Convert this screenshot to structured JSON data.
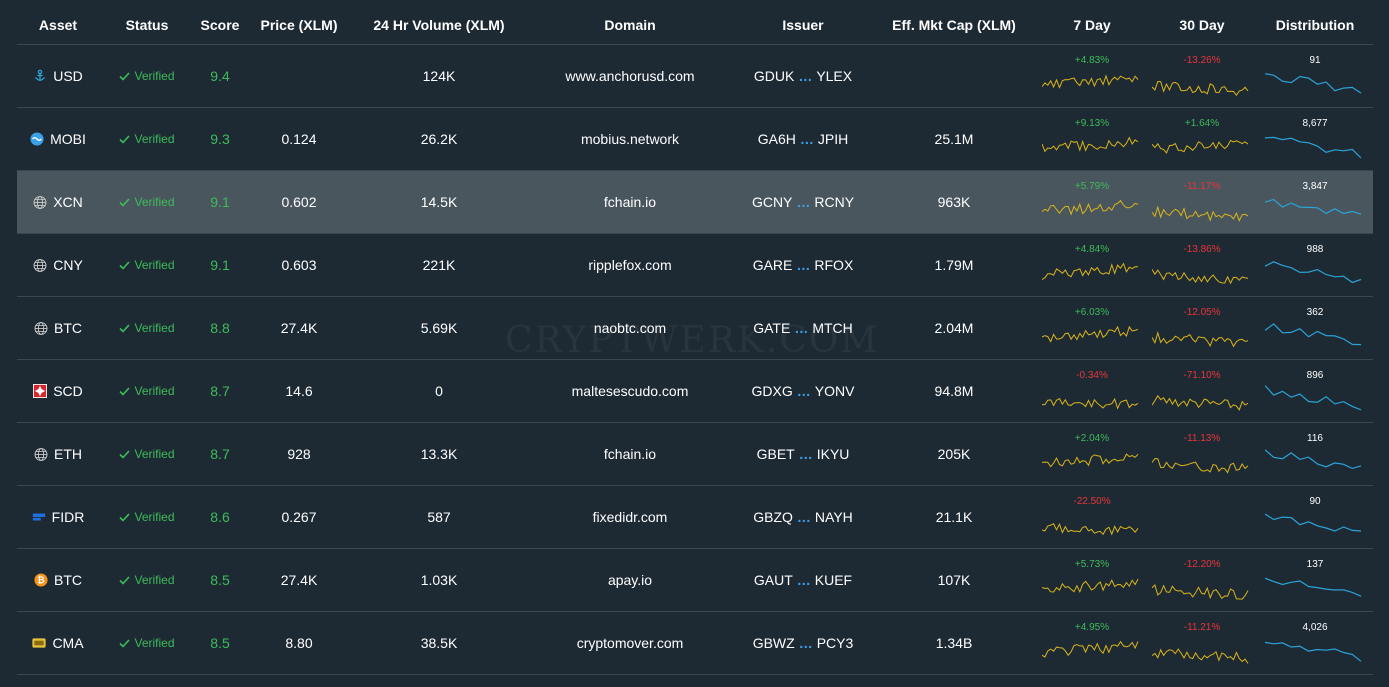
{
  "columns": [
    "Asset",
    "Status",
    "Score",
    "Price (XLM)",
    "24 Hr Volume (XLM)",
    "Domain",
    "Issuer",
    "Eff. Mkt Cap (XLM)",
    "7 Day",
    "30 Day",
    "Distribution"
  ],
  "watermark": "CRYPTWERK.COM",
  "rows": [
    {
      "asset": "USD",
      "icon": "anchor-icon",
      "status": "Verified",
      "score": "9.4",
      "price": "",
      "volume": "124K",
      "domain": "www.anchorusd.com",
      "issuer_start": "GDUK",
      "issuer_end": "YLEX",
      "mcap": "",
      "d7": "+4.83%",
      "d30": "-13.26%",
      "dist": "91"
    },
    {
      "asset": "MOBI",
      "icon": "mobius-icon",
      "status": "Verified",
      "score": "9.3",
      "price": "0.124",
      "volume": "26.2K",
      "domain": "mobius.network",
      "issuer_start": "GA6H",
      "issuer_end": "JPIH",
      "mcap": "25.1M",
      "d7": "+9.13%",
      "d30": "+1.64%",
      "dist": "8,677"
    },
    {
      "asset": "XCN",
      "icon": "globe-icon",
      "status": "Verified",
      "score": "9.1",
      "price": "0.602",
      "volume": "14.5K",
      "domain": "fchain.io",
      "issuer_start": "GCNY",
      "issuer_end": "RCNY",
      "mcap": "963K",
      "d7": "+5.79%",
      "d30": "-11.17%",
      "dist": "3,847"
    },
    {
      "asset": "CNY",
      "icon": "globe-icon",
      "status": "Verified",
      "score": "9.1",
      "price": "0.603",
      "volume": "221K",
      "domain": "ripplefox.com",
      "issuer_start": "GARE",
      "issuer_end": "RFOX",
      "mcap": "1.79M",
      "d7": "+4.84%",
      "d30": "-13.86%",
      "dist": "988"
    },
    {
      "asset": "BTC",
      "icon": "globe-icon",
      "status": "Verified",
      "score": "8.8",
      "price": "27.4K",
      "volume": "5.69K",
      "domain": "naobtc.com",
      "issuer_start": "GATE",
      "issuer_end": "MTCH",
      "mcap": "2.04M",
      "d7": "+6.03%",
      "d30": "-12.05%",
      "dist": "362"
    },
    {
      "asset": "SCD",
      "icon": "scudo-icon",
      "status": "Verified",
      "score": "8.7",
      "price": "14.6",
      "volume": "0",
      "domain": "maltesescudo.com",
      "issuer_start": "GDXG",
      "issuer_end": "YONV",
      "mcap": "94.8M",
      "d7": "-0.34%",
      "d30": "-71.10%",
      "dist": "896"
    },
    {
      "asset": "ETH",
      "icon": "globe-icon",
      "status": "Verified",
      "score": "8.7",
      "price": "928",
      "volume": "13.3K",
      "domain": "fchain.io",
      "issuer_start": "GBET",
      "issuer_end": "IKYU",
      "mcap": "205K",
      "d7": "+2.04%",
      "d30": "-11.13%",
      "dist": "116"
    },
    {
      "asset": "FIDR",
      "icon": "fidr-icon",
      "status": "Verified",
      "score": "8.6",
      "price": "0.267",
      "volume": "587",
      "domain": "fixedidr.com",
      "issuer_start": "GBZQ",
      "issuer_end": "NAYH",
      "mcap": "21.1K",
      "d7": "-22.50%",
      "d30": "",
      "dist": "90"
    },
    {
      "asset": "BTC",
      "icon": "bitcoin-icon",
      "status": "Verified",
      "score": "8.5",
      "price": "27.4K",
      "volume": "1.03K",
      "domain": "apay.io",
      "issuer_start": "GAUT",
      "issuer_end": "KUEF",
      "mcap": "107K",
      "d7": "+5.73%",
      "d30": "-12.20%",
      "dist": "137"
    },
    {
      "asset": "CMA",
      "icon": "cma-icon",
      "status": "Verified",
      "score": "8.5",
      "price": "8.80",
      "volume": "38.5K",
      "domain": "cryptomover.com",
      "issuer_start": "GBWZ",
      "issuer_end": "PCY3",
      "mcap": "1.34B",
      "d7": "+4.95%",
      "d30": "-11.21%",
      "dist": "4,026"
    }
  ],
  "colors": {
    "background": "#1e2a33",
    "verified": "#3dbb5a",
    "positive": "#3dbb5a",
    "negative": "#e8343a",
    "spark": "#d9b51a",
    "distribution": "#2ba3d8",
    "issuer_dots": "#3aa0e8",
    "highlight": "#4a565e"
  }
}
